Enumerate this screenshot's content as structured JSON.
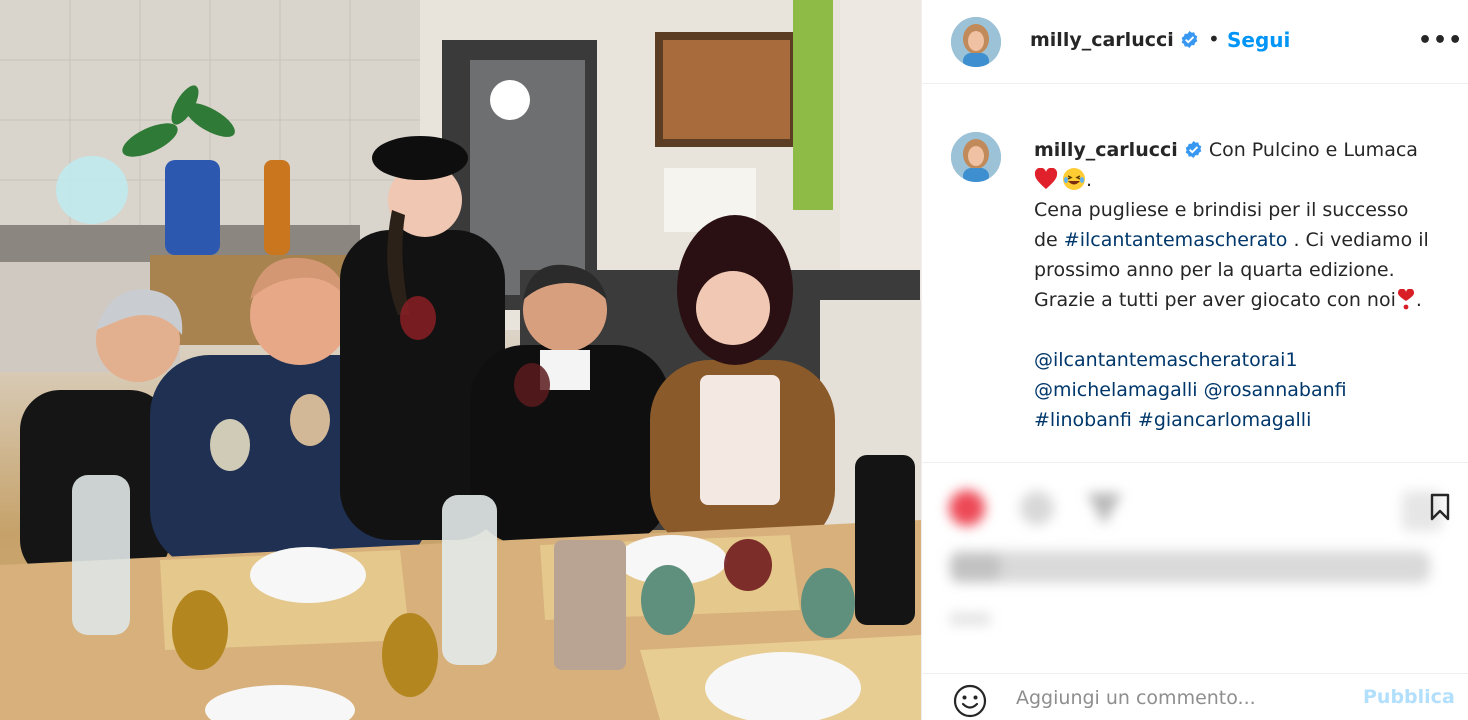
{
  "post": {
    "username": "milly_carlucci",
    "follow_label": "Segui",
    "separator": "•",
    "more_label": "•••",
    "photo_icon": "restaurant-group-photo"
  },
  "caption": {
    "lines": [
      "Con Pulcino e Lumaca",
      "",
      "Cena pugliese e brindisi per il successo",
      "de ",
      " . Ci vediamo il",
      "prossimo anno per la quarta edizione.",
      "Grazie a tutti per aver giocato con noi",
      "."
    ],
    "hashtag_show": "#ilcantantemascherato",
    "mentions_line1": "@ilcantantemascheratorai1",
    "mentions_line2a": "@michelamagalli",
    "mentions_line2b": "@rosannabanfi",
    "tags_line3a": "#linobanfi",
    "tags_line3b": "#giancarlomagalli"
  },
  "comment": {
    "placeholder": "Aggiungi un commento...",
    "publish_label": "Pubblica"
  },
  "colors": {
    "accent": "#0095f6",
    "link": "#00376b",
    "publish_disabled": "#b2dffc"
  },
  "icons": [
    "verified-badge-icon",
    "more-options-icon",
    "heart-emoji-icon",
    "laughing-emoji-icon",
    "red-exclamation-heart-icon",
    "like-icon",
    "comment-icon",
    "share-icon",
    "save-icon",
    "emoji-smile-icon"
  ]
}
